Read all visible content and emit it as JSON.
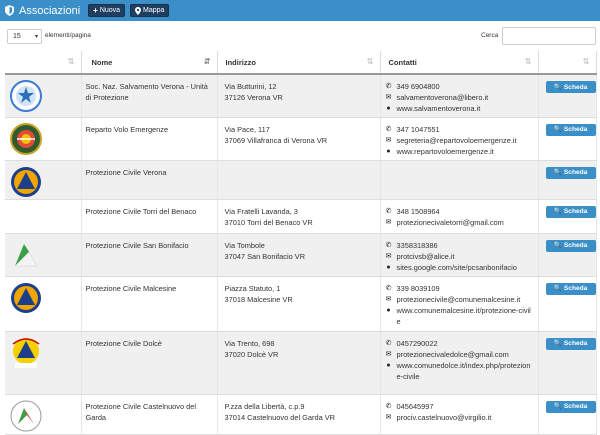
{
  "header": {
    "title": "Associazioni",
    "btn_new": "Nuova",
    "btn_map": "Mappa"
  },
  "controls": {
    "page_length": "15",
    "page_length_label": "elementi/pagina",
    "search_label": "Cerca",
    "search_value": ""
  },
  "columns": [
    "Nome",
    "Indirizzo",
    "Contatti"
  ],
  "action_label": "Scheda",
  "rows": [
    {
      "name": "Soc. Naz. Salvamento Verona - Unità di Protezione",
      "addr1": "Via Butturini, 12",
      "addr2": "37126 Verona VR",
      "phone": "349 6904800",
      "email": "salvamentoverona@libero.it",
      "web": "www.salvamentoverona.it"
    },
    {
      "name": "Reparto Volo Emergenze",
      "addr1": "Via Pace, 117",
      "addr2": "37069 Villafranca di Verona VR",
      "phone": "347 1047551",
      "email": "segreteria@repartovoloemergenze.it",
      "web": "www.repartovoloemergenze.it"
    },
    {
      "name": "Protezione Civile Verona",
      "addr1": "",
      "addr2": "",
      "phone": "",
      "email": "",
      "web": ""
    },
    {
      "name": "Protezione Civile Torri del Benaco",
      "addr1": "Via Fratelli Lavanda, 3",
      "addr2": "37010 Torri del Benaco VR",
      "phone": "348 1508964",
      "email": "protezionecivaletorri@gmail.com",
      "web": ""
    },
    {
      "name": "Protezione Civile San Bonifacio",
      "addr1": "Via Tombole",
      "addr2": "37047 San Bonifacio VR",
      "phone": "3358318386",
      "email": "protcivsb@alice.it",
      "web": "sites.google.com/site/pcsanbonifacio"
    },
    {
      "name": "Protezione Civile Malcesine",
      "addr1": "Piazza Statuto, 1",
      "addr2": "37018 Malcesine VR",
      "phone": "339 8039109",
      "email": "protezionecivile@comunemalcesine.it",
      "web": "www.comunemalcesine.it/protezione-civile"
    },
    {
      "name": "Protezione Civile Dolcè",
      "addr1": "Via Trento, 698",
      "addr2": "37020 Dolcè VR",
      "phone": "0457290022",
      "email": "protezionecivaledolce@gmail.com",
      "web": "www.comunedolce.it/index.php/protezione-civile"
    },
    {
      "name": "Protezione Civile Castelnuovo del Garda",
      "addr1": "P.zza della Libertà, c.p.9",
      "addr2": "37014 Castelnuovo del Garda VR",
      "phone": "045645997",
      "email": "prociv.castelnuovo@virgilio.it",
      "web": ""
    }
  ],
  "colors": {
    "topbar": "#3a8fc8",
    "button_dark": "#1f3f60",
    "button_blue": "#3a8fc8"
  },
  "icons": {
    "phone": "phone-icon",
    "email": "envelope-icon",
    "web": "globe-icon",
    "search": "search-icon",
    "shield": "shield-icon",
    "plus": "plus-icon",
    "map": "map-marker-icon"
  }
}
